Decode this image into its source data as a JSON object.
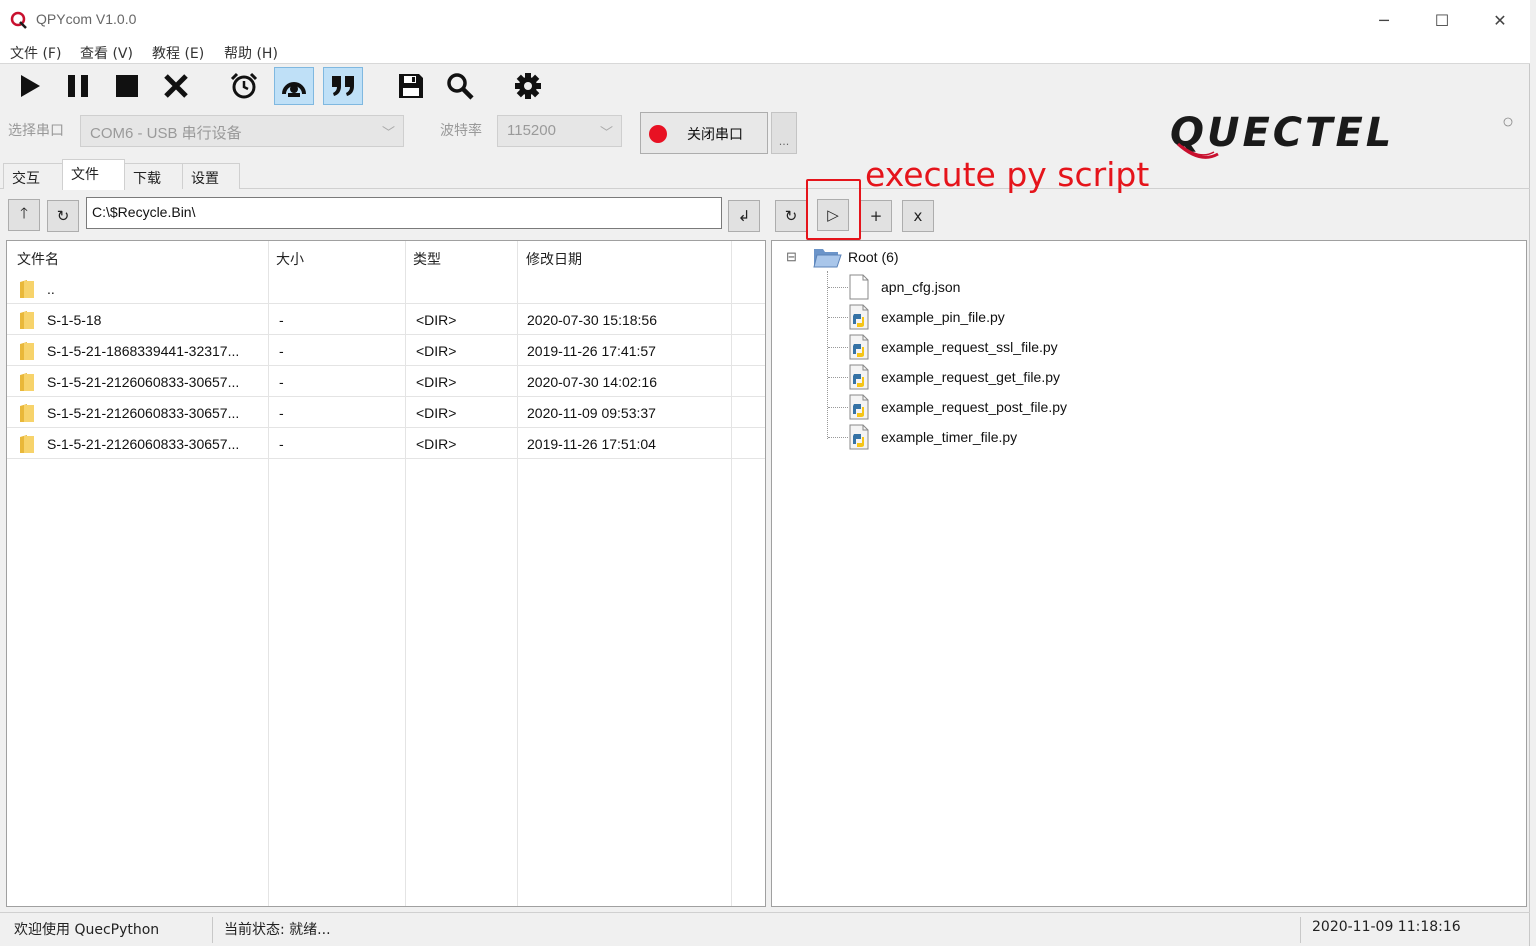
{
  "window": {
    "title": "QPYcom V1.0.0",
    "minimize": "─",
    "maximize": "☐",
    "close": "✕"
  },
  "menu": [
    "文件 (F)",
    "查看 (V)",
    "教程 (E)",
    "帮助 (H)"
  ],
  "toolbar": {
    "icons": [
      "play-icon",
      "pause-icon",
      "stop-icon",
      "close-icon",
      "alarm-clock-icon",
      "record-icon",
      "quote-icon",
      "save-icon",
      "search-icon",
      "gear-icon"
    ],
    "active": [
      "record-icon",
      "quote-icon"
    ]
  },
  "port": {
    "label": "选择串口",
    "value": "COM6 - USB 串行设备",
    "baud_label": "波特率",
    "baud_value": "115200",
    "close_label": "关闭串口",
    "more_label": "...",
    "status_color": "#e81123"
  },
  "brand": {
    "logo_text": "QUECTEL",
    "color": "#1a1a1a",
    "accent": "#c8102e"
  },
  "tabs": [
    {
      "label": "交互",
      "selected": false
    },
    {
      "label": "文件",
      "selected": true
    },
    {
      "label": "下载",
      "selected": false
    },
    {
      "label": "设置",
      "selected": false
    }
  ],
  "local": {
    "up_label": "🡑",
    "refresh_label": "↻",
    "path": "C:\\$Recycle.Bin\\",
    "go_label": "↲",
    "columns": [
      "文件名",
      "大小",
      "类型",
      "修改日期"
    ],
    "rows": [
      {
        "name": "..",
        "size": "",
        "type": "",
        "date": ""
      },
      {
        "name": "S-1-5-18",
        "size": "-",
        "type": "<DIR>",
        "date": "2020-07-30 15:18:56"
      },
      {
        "name": "S-1-5-21-1868339441-32317...",
        "size": "-",
        "type": "<DIR>",
        "date": "2019-11-26 17:41:57"
      },
      {
        "name": "S-1-5-21-2126060833-30657...",
        "size": "-",
        "type": "<DIR>",
        "date": "2020-07-30 14:02:16"
      },
      {
        "name": "S-1-5-21-2126060833-30657...",
        "size": "-",
        "type": "<DIR>",
        "date": "2020-11-09 09:53:37"
      },
      {
        "name": "S-1-5-21-2126060833-30657...",
        "size": "-",
        "type": "<DIR>",
        "date": "2019-11-26 17:51:04"
      }
    ]
  },
  "device": {
    "refresh_label": "↻",
    "run_label": "▷",
    "add_label": "+",
    "delete_label": "x",
    "root_label": "Root (6)",
    "collapse_label": "⊟",
    "files": [
      {
        "name": "apn_cfg.json",
        "kind": "json"
      },
      {
        "name": "example_pin_file.py",
        "kind": "py"
      },
      {
        "name": "example_request_ssl_file.py",
        "kind": "py"
      },
      {
        "name": "example_request_get_file.py",
        "kind": "py"
      },
      {
        "name": "example_request_post_file.py",
        "kind": "py"
      },
      {
        "name": "example_timer_file.py",
        "kind": "py"
      }
    ]
  },
  "annotation": {
    "text": "execute py script",
    "color": "#e5141b"
  },
  "status": {
    "welcome": "欢迎使用 QuecPython",
    "state": "当前状态: 就绪...",
    "time": "2020-11-09 11:18:16"
  }
}
